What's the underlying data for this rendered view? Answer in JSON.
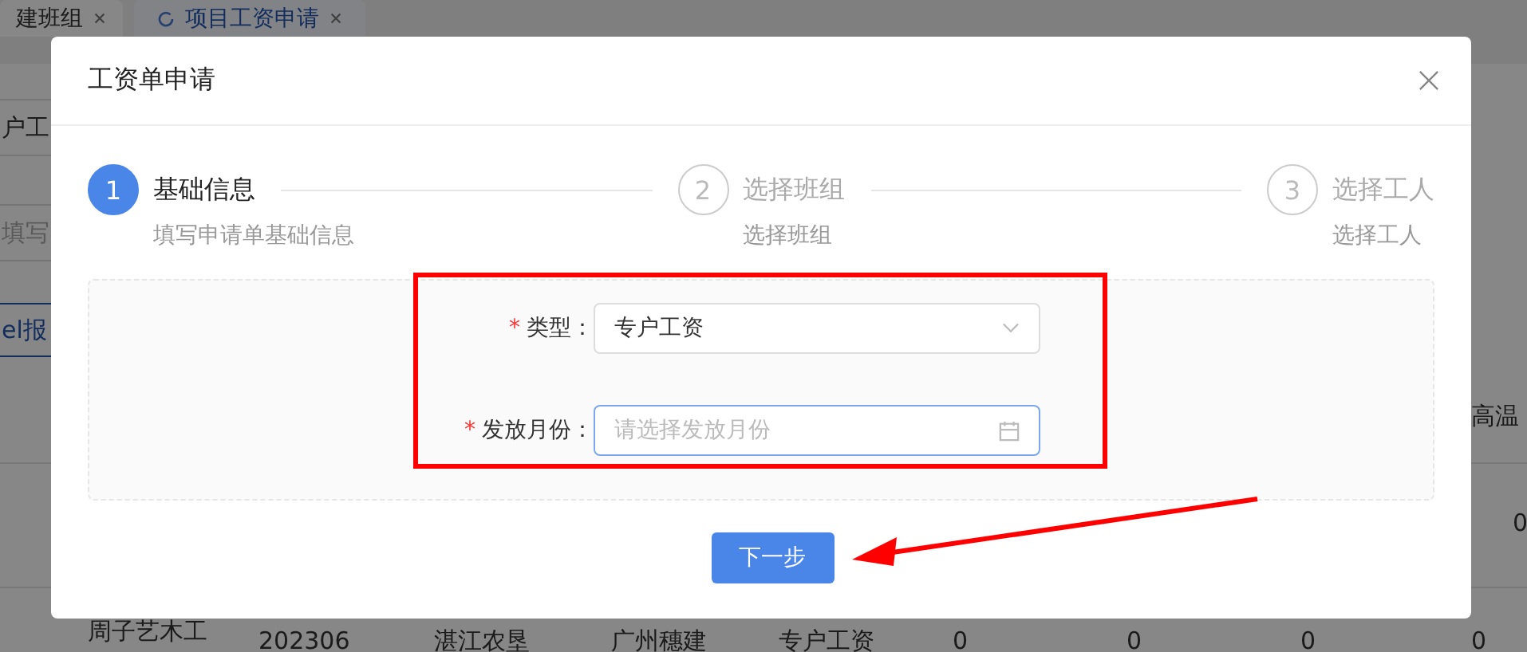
{
  "background": {
    "tabs": [
      {
        "label": "建班组",
        "selected": false
      },
      {
        "label": "项目工资申请",
        "selected": true
      }
    ],
    "filter_value": "户工",
    "filter_placeholder": "填写",
    "export_link": "el报",
    "header_cell": "高温",
    "rows": [
      {
        "cells": [
          "0"
        ]
      },
      {
        "cells": [
          "周子艺木工",
          "202306",
          "湛江农垦",
          "广州穗建",
          "专户工资",
          "0",
          "0",
          "0",
          "0"
        ]
      }
    ]
  },
  "dialog": {
    "title": "工资单申请",
    "steps": [
      {
        "number": "1",
        "title": "基础信息",
        "description": "填写申请单基础信息",
        "selected": true
      },
      {
        "number": "2",
        "title": "选择班组",
        "description": "选择班组",
        "selected": false
      },
      {
        "number": "3",
        "title": "选择工人",
        "description": "选择工人",
        "selected": false
      }
    ],
    "required_mark": "*",
    "fields": [
      {
        "kind": "select",
        "label": "类型：",
        "required": true,
        "value": "专户工资",
        "focused": false
      },
      {
        "kind": "date",
        "label": "发放月份：",
        "required": true,
        "placeholder": "请选择发放月份",
        "focused": true
      }
    ],
    "next_button": "下一步"
  }
}
